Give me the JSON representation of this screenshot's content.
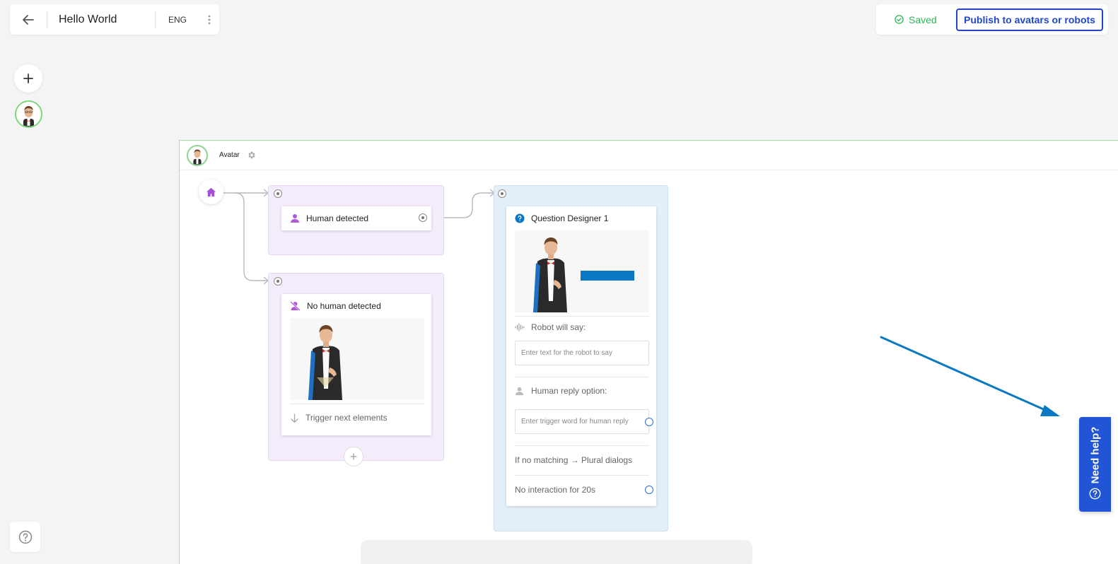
{
  "header": {
    "title": "Hello World",
    "language": "ENG",
    "saved_label": "Saved",
    "publish_label": "Publish to avatars or robots"
  },
  "canvas": {
    "frame_label": "Avatar"
  },
  "nodes": {
    "human_detected": {
      "title": "Human detected"
    },
    "no_human_detected": {
      "title": "No human detected",
      "trigger_label": "Trigger next elements"
    },
    "question_designer": {
      "title": "Question Designer 1",
      "robot_will_say_label": "Robot will say:",
      "robot_input_placeholder": "Enter text for the robot to say",
      "human_reply_label": "Human reply option:",
      "human_reply_placeholder": "Enter trigger word for human reply",
      "no_matching_label": "If no matching → Plural dialogs",
      "no_interaction_label": "No interaction for 20s"
    }
  },
  "help_tab": {
    "label": "Need help?"
  },
  "colors": {
    "accent_blue": "#2155d6",
    "saved_green": "#2fb35a",
    "purple_group": "#f5ecfb",
    "blue_group": "#e4f0f9",
    "arrow_blue": "#0a78c2",
    "node_icon_purple": "#b05ad8"
  },
  "icons": {
    "back": "arrow-left-icon",
    "menu": "vertical-dots-icon",
    "saved": "check-circle-icon",
    "add": "plus-icon",
    "help": "question-circle-icon",
    "settings": "gear-icon",
    "home": "home-icon",
    "person": "person-icon",
    "no_person": "person-off-icon",
    "question": "question-circle-icon",
    "sound": "sound-wave-icon",
    "trigger": "arrow-down-icon"
  }
}
